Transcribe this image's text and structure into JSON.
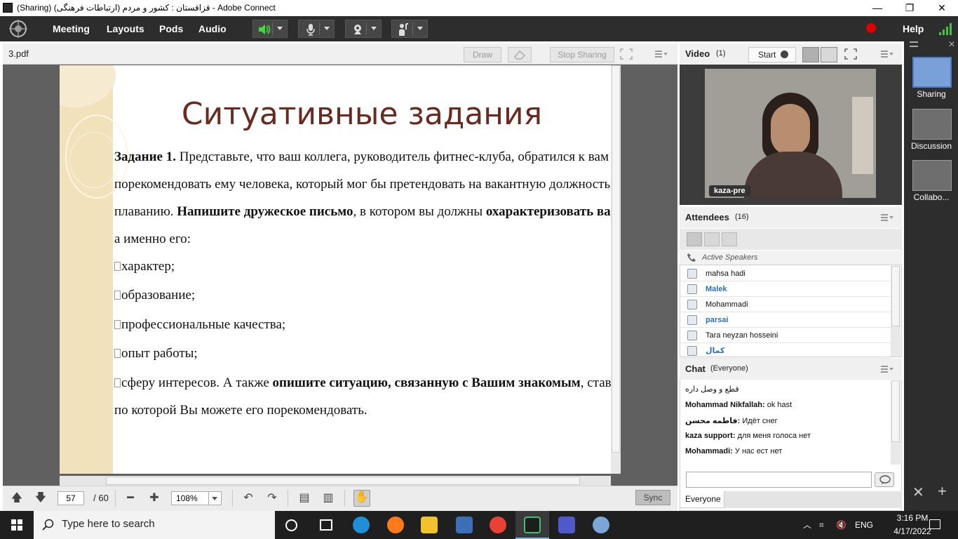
{
  "window": {
    "title": "(Sharing) قزاقستان : کشور و مردم (ارتباطات فرهنگی) - Adobe Connect",
    "minimize": "—",
    "restore": "❐",
    "close": "✕"
  },
  "menubar": {
    "items": [
      "Meeting",
      "Layouts",
      "Pods",
      "Audio"
    ],
    "help": "Help"
  },
  "share_pod": {
    "filename": "3.pdf",
    "draw_label": "Draw",
    "stop_sharing_label": "Stop Sharing",
    "current_page": "57",
    "total_pages": "/ 60",
    "zoom": "108%",
    "sync_label": "Sync"
  },
  "slide": {
    "title": "Ситуативные задания",
    "lines": [
      {
        "b1": "Задание 1.",
        "t1": " Представьте, что ваш коллега, руководитель фитнес-клуба, обратился к вам с просьбой"
      },
      {
        "t1": "порекомендовать ему человека, который мог бы претендовать на вакантную должность инструктора по"
      },
      {
        "t1": "плаванию. ",
        "b1": "Напишите дружеское письмо",
        "t2": ", в котором вы должны ",
        "b2": "охарактеризовать вашего знакомого",
        "t3": ","
      },
      {
        "t1": "а именно его:"
      },
      {
        "t1": "характер;"
      },
      {
        "t1": "образование;"
      },
      {
        "t1": "профессиональные качества;"
      },
      {
        "t1": "опыт работы;"
      },
      {
        "t1": "сферу интересов. А также ",
        "b1": "опишите ситуацию, связанную с Вашим знакомым",
        "t2": ", ставшую причиной,"
      },
      {
        "t1": "по которой Вы можете его порекомендовать."
      }
    ]
  },
  "video_pod": {
    "title": "Video",
    "count": "(1)",
    "start_label": "Start",
    "presenter": "kaza-pre"
  },
  "attendees_pod": {
    "title": "Attendees",
    "count": "(16)",
    "active_speakers": "Active Speakers",
    "list": [
      {
        "name": "mahsa hadi",
        "highlight": false
      },
      {
        "name": "Malek",
        "highlight": true
      },
      {
        "name": "Mohammadi",
        "highlight": false
      },
      {
        "name": "parsai",
        "highlight": true
      },
      {
        "name": "Tara neyzan hosseini",
        "highlight": false
      },
      {
        "name": "کمال",
        "highlight": true
      }
    ]
  },
  "chat_pod": {
    "title": "Chat",
    "scope": "(Everyone)",
    "messages": [
      {
        "sender": "",
        "text": "قطع و وصل داره"
      },
      {
        "sender": "Mohammad Nikfallah:",
        "text": " ok hast"
      },
      {
        "sender": "فاطمه محسن:",
        "text": " Идёт снег"
      },
      {
        "sender": "kaza support:",
        "text": " для меня голоса нет"
      },
      {
        "sender": "Mohammadi:",
        "text": " У нас ест нет"
      }
    ],
    "tab": "Everyone"
  },
  "layouts": [
    {
      "label": "Sharing",
      "selected": true
    },
    {
      "label": "Discussion",
      "selected": false
    },
    {
      "label": "Collabo...",
      "selected": false
    }
  ],
  "taskbar": {
    "search_placeholder": "Type here to search",
    "lang": "ENG",
    "time": "3:16 PM",
    "date": "4/17/2022"
  },
  "colors": {
    "menubar": "#2d2d2d",
    "slide_title": "#6b2a20",
    "record": "#e00000",
    "highlight_name": "#2a6fc0",
    "layout_selected": "#7aa0d8"
  }
}
